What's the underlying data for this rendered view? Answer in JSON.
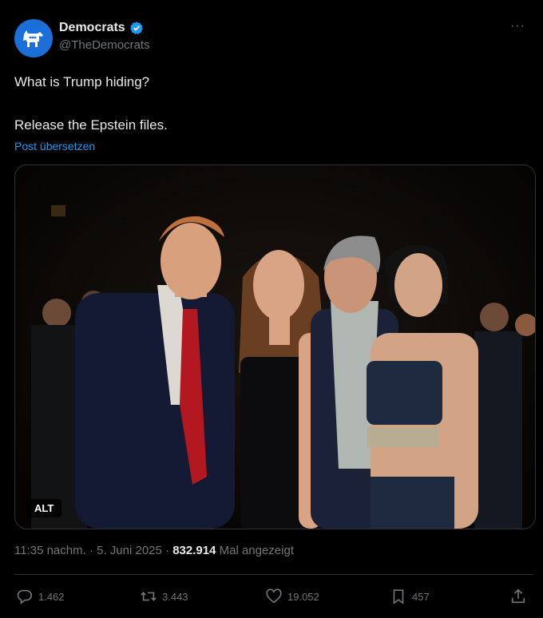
{
  "author": {
    "display_name": "Democrats",
    "handle": "@TheDemocrats",
    "avatar_icon": "donkey-icon",
    "verified_icon": "verified-badge-icon",
    "accent": "#1d9bf0"
  },
  "more_icon_label": "···",
  "tweet": {
    "line1": "What is Trump hiding?",
    "line2": "Release the Epstein files.",
    "translate_label": "Post übersetzen"
  },
  "media": {
    "alt_label": "ALT"
  },
  "meta": {
    "time": "11:35 nachm.",
    "separator1": " · ",
    "date": "5. Juni 2025",
    "separator2": " · ",
    "views": "832.914",
    "views_label": " Mal angezeigt"
  },
  "actions": {
    "replies": "1.462",
    "reposts": "3.443",
    "likes": "19.052",
    "bookmarks": "457"
  }
}
